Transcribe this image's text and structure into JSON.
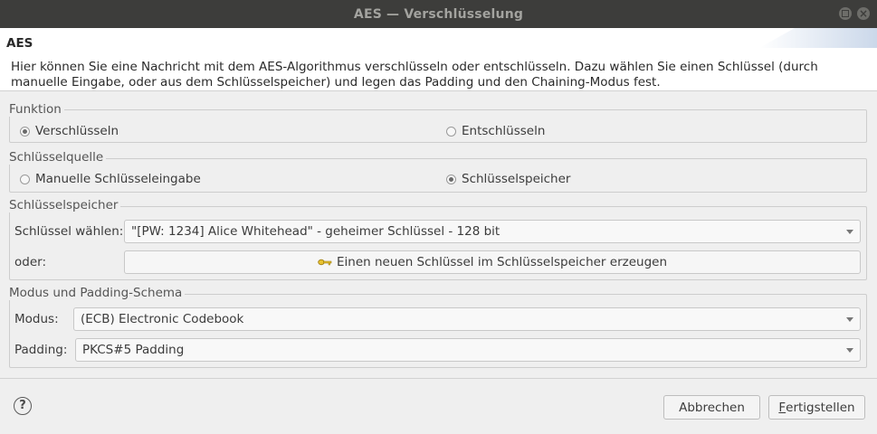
{
  "window": {
    "title": "AES — Verschlüsselung"
  },
  "header": {
    "title": "AES",
    "description": "Hier können Sie eine Nachricht mit dem AES-Algorithmus verschlüsseln oder entschlüsseln. Dazu wählen Sie einen Schlüssel (durch manuelle Eingabe, oder aus dem Schlüsselspeicher) und legen das Padding und den Chaining-Modus fest."
  },
  "funktion": {
    "label": "Funktion",
    "options": [
      {
        "label": "Verschlüsseln",
        "checked": true
      },
      {
        "label": "Entschlüsseln",
        "checked": false
      }
    ]
  },
  "schluesselquelle": {
    "label": "Schlüsselquelle",
    "options": [
      {
        "label": "Manuelle Schlüsseleingabe",
        "checked": false
      },
      {
        "label": "Schlüsselspeicher",
        "checked": true
      }
    ]
  },
  "schluesselspeicher": {
    "label": "Schlüsselspeicher",
    "key_label": "Schlüssel wählen:",
    "key_value": "\"[PW: 1234] Alice Whitehead\" - geheimer Schlüssel - 128 bit",
    "or_label": "oder:",
    "generate_button": "Einen neuen Schlüssel im Schlüsselspeicher erzeugen",
    "generate_icon": "key-icon"
  },
  "modus": {
    "label": "Modus und Padding-Schema",
    "mode_label": "Modus:",
    "mode_value": "(ECB) Electronic Codebook",
    "padding_label": "Padding:",
    "padding_value": "PKCS#5 Padding"
  },
  "footer": {
    "help_symbol": "?",
    "cancel": "Abbrechen",
    "finish_mnemonic": "F",
    "finish_rest": "ertigstellen"
  }
}
